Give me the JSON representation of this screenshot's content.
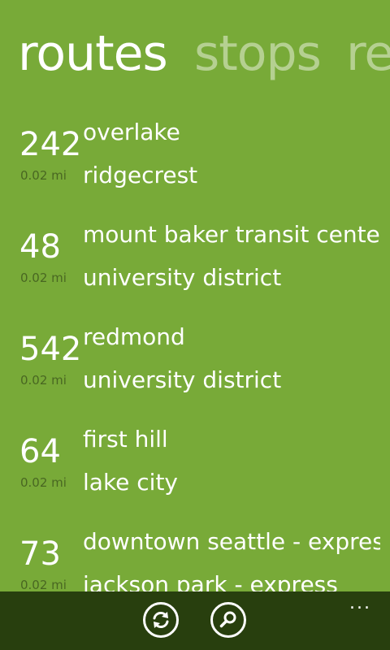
{
  "pivot": {
    "tabs": [
      {
        "label": "routes"
      },
      {
        "label": "stops"
      },
      {
        "label": "re"
      }
    ]
  },
  "routes": [
    {
      "number": "242",
      "distance": "0.02 mi",
      "from": "overlake",
      "to": "ridgecrest"
    },
    {
      "number": "48",
      "distance": "0.02 mi",
      "from": "mount baker transit cente",
      "to": "university district"
    },
    {
      "number": "542",
      "distance": "0.02 mi",
      "from": "redmond",
      "to": "university district"
    },
    {
      "number": "64",
      "distance": "0.02 mi",
      "from": "first hill",
      "to": "lake city"
    },
    {
      "number": "73",
      "distance": "0.02 mi",
      "from": "downtown seattle - expres",
      "to": "jackson park - express"
    }
  ],
  "app_bar": {
    "buttons": [
      {
        "icon": "refresh-icon"
      },
      {
        "icon": "search-icon"
      }
    ],
    "more_label": "..."
  },
  "colors": {
    "background": "#78AA38",
    "app_bar": "#283F0E",
    "distance_text": "#4D6D24"
  }
}
